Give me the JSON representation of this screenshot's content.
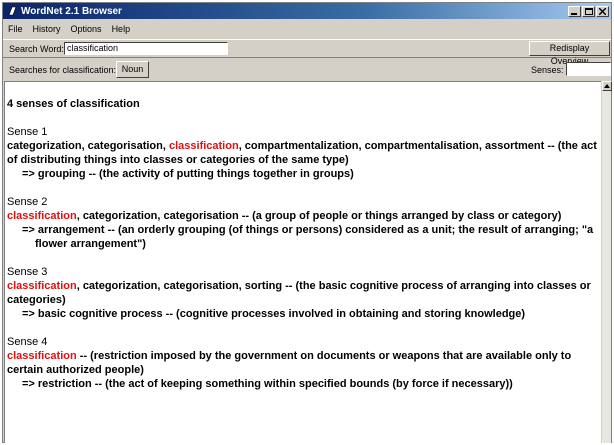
{
  "window": {
    "title": "WordNet 2.1 Browser",
    "icons": [
      "app-icon",
      "minimize-icon",
      "maximize-icon",
      "close-icon"
    ]
  },
  "menu": [
    "File",
    "History",
    "Options",
    "Help"
  ],
  "search": {
    "label": "Search Word:",
    "value": "classification",
    "redisplay_label": "Redisplay Overview"
  },
  "searches": {
    "label": "Searches for classification:",
    "noun_label": "Noun",
    "senses_label": "Senses:",
    "senses_value": ""
  },
  "results": {
    "heading": "4 senses of classification",
    "senses": [
      {
        "title": "Sense 1",
        "pre": "categorization, categorisation, ",
        "highlight": "classification",
        "post": ", compartmentalization, compartmentalisation, assortment -- (the act of distributing things into classes or categories of the same type)",
        "hypernym": "=> grouping -- (the activity of putting things together in groups)"
      },
      {
        "title": "Sense 2",
        "pre": "",
        "highlight": "classification",
        "post": ", categorization, categorisation -- (a group of people or things arranged by class or category)",
        "hypernym": "=> arrangement -- (an orderly grouping (of things or persons) considered as a unit; the result of arranging; \"a flower arrangement\")"
      },
      {
        "title": "Sense 3",
        "pre": "",
        "highlight": "classification",
        "post": ", categorization, categorisation, sorting -- (the basic cognitive process of arranging into classes or categories)",
        "hypernym": "=> basic cognitive process -- (cognitive processes involved in obtaining and storing knowledge)"
      },
      {
        "title": "Sense 4",
        "pre": "",
        "highlight": "classification",
        "post": " -- (restriction imposed by the government on documents or weapons that are available only to certain authorized people)",
        "hypernym": "=> restriction -- (the act of keeping something within specified bounds (by force if necessary))"
      }
    ]
  },
  "colors": {
    "highlight": "#e01010",
    "titlebar": "#0a246a",
    "face": "#d4d0c8"
  }
}
